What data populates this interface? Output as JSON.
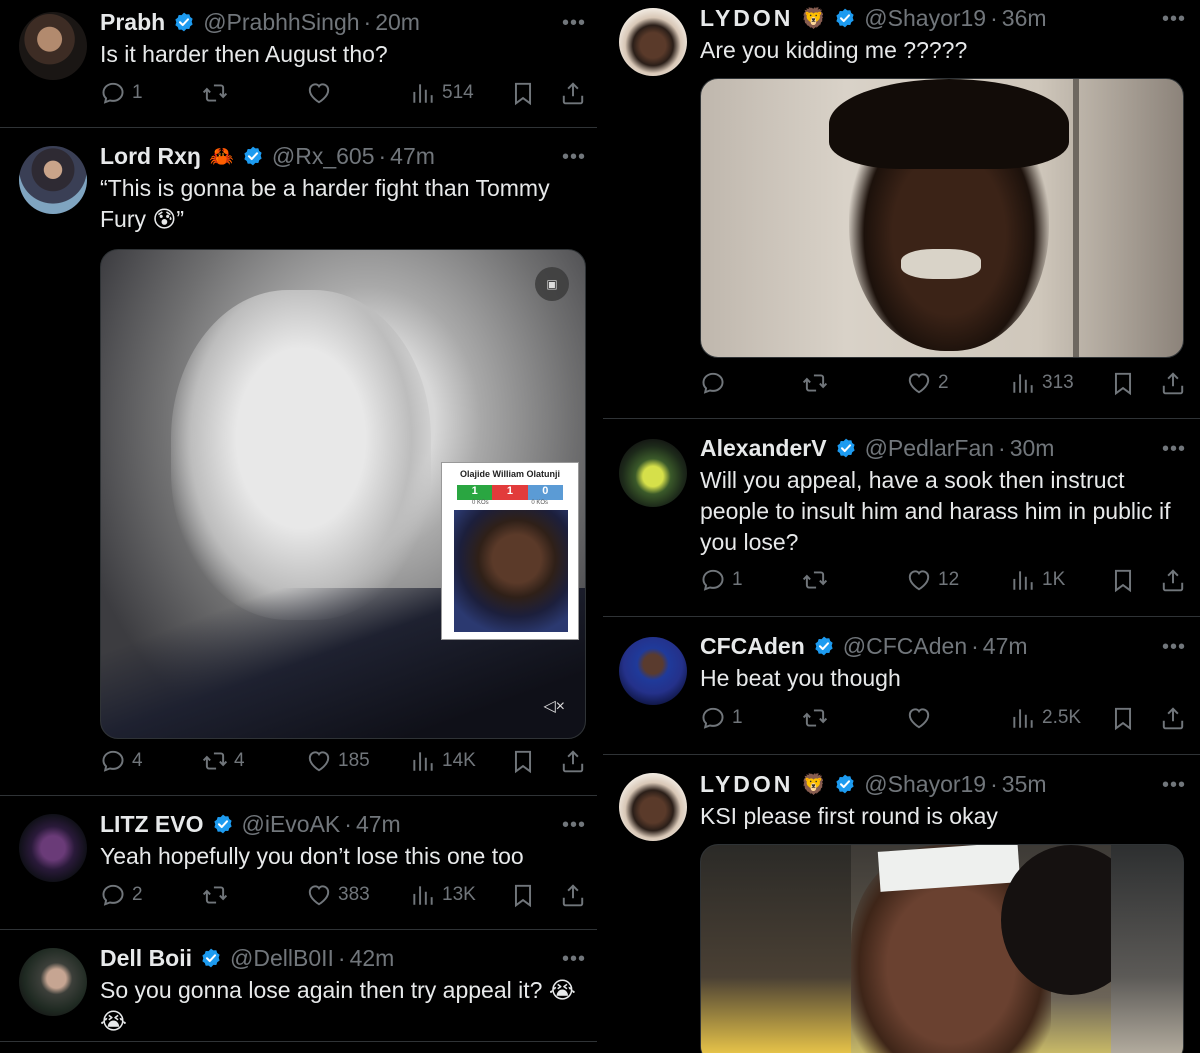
{
  "left": {
    "t1": {
      "name": "Prabh",
      "handle": "@PrabhhSingh",
      "time": "20m",
      "text": "Is it harder then August tho?",
      "replies": "1",
      "retweets": "",
      "likes": "",
      "views": "514"
    },
    "t2": {
      "name": "Lord Rxŋ",
      "badge_emoji": "🦀",
      "handle": "@Rx_605",
      "time": "47m",
      "text": "“This is gonna be a harder fight than Tommy Fury 😰”",
      "inset_title": "Olajide William Olatunji",
      "inset_scores": [
        "1",
        "1",
        "0"
      ],
      "inset_sub": [
        "0 KOs",
        "0 KOs"
      ],
      "replies": "4",
      "retweets": "4",
      "likes": "185",
      "views": "14K"
    },
    "t3": {
      "name": "LITZ EVO",
      "handle": "@iEvoAK",
      "time": "47m",
      "text": "Yeah hopefully you don’t lose this one too",
      "replies": "2",
      "retweets": "",
      "likes": "383",
      "views": "13K"
    },
    "t4": {
      "name": "Dell Boii",
      "handle": "@DellB0II",
      "time": "42m",
      "text": "So you gonna lose again then try appeal it? 😭 😭"
    }
  },
  "right": {
    "t1": {
      "name": "LYDON",
      "badge_emoji": "🦁",
      "handle": "@Shayor19",
      "time": "36m",
      "text": "Are you kidding me ?????",
      "replies": "",
      "retweets": "",
      "likes": "2",
      "views": "313"
    },
    "t2": {
      "name": "AlexanderV",
      "handle": "@PedlarFan",
      "time": "30m",
      "text": "Will you appeal, have a sook then instruct people to insult him and harass him in public if you lose?",
      "replies": "1",
      "retweets": "",
      "likes": "12",
      "views": "1K"
    },
    "t3": {
      "name": "CFCAden",
      "handle": "@CFCAden",
      "time": "47m",
      "text": "He beat you though",
      "replies": "1",
      "retweets": "",
      "likes": "",
      "views": "2.5K"
    },
    "t4": {
      "name": "LYDON",
      "badge_emoji": "🦁",
      "handle": "@Shayor19",
      "time": "35m",
      "text": "KSI please first round is okay"
    }
  },
  "icons": {
    "reply": "reply-icon",
    "retweet": "retweet-icon",
    "like": "heart-icon",
    "views": "views-icon",
    "bookmark": "bookmark-icon",
    "share": "share-icon",
    "more": "more-icon",
    "verified": "verified-badge-icon",
    "mute": "mute-icon",
    "gif": "gif-icon"
  },
  "colors": {
    "background": "#000000",
    "text": "#e7e9ea",
    "muted": "#71767b",
    "verified": "#1d9bf0",
    "divider": "#2f3336"
  },
  "more_label": "•••"
}
